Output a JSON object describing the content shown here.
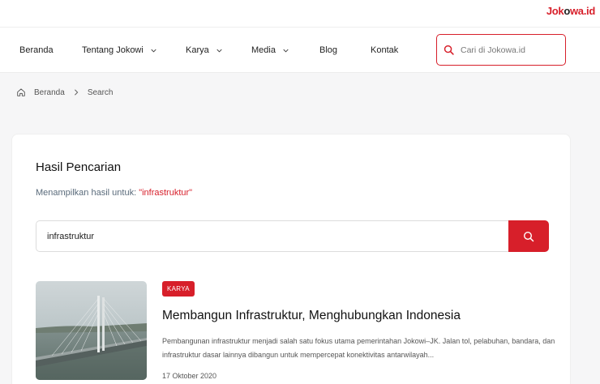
{
  "brand": {
    "logo_part1": "Jok",
    "logo_part2": "o",
    "logo_part3": "wa.id",
    "accent": "#d71f2a"
  },
  "nav": {
    "items": [
      {
        "label": "Beranda",
        "has_dropdown": false
      },
      {
        "label": "Tentang Jokowi",
        "has_dropdown": true
      },
      {
        "label": "Karya",
        "has_dropdown": true
      },
      {
        "label": "Media",
        "has_dropdown": true
      },
      {
        "label": "Blog",
        "has_dropdown": false
      },
      {
        "label": "Kontak",
        "has_dropdown": false
      }
    ],
    "search_placeholder": "Cari di Jokowa.id"
  },
  "breadcrumb": {
    "home": "Beranda",
    "current": "Search"
  },
  "main": {
    "title": "Hasil Pencarian",
    "subtitle_prefix": "Menampilkan hasil untuk: ",
    "query_quoted": "\"infrastruktur\"",
    "search_value": "infrastruktur"
  },
  "results": [
    {
      "badge": "KARYA",
      "title": "Membangun Infrastruktur, Menghubungkan Indonesia",
      "excerpt": "Pembangunan infrastruktur menjadi salah satu fokus utama pemerintahan Jokowi–JK. Jalan tol, pelabuhan, bandara, dan infrastruktur dasar lainnya dibangun untuk mempercepat konektivitas antarwilayah...",
      "date": "17 Oktober 2020",
      "image": "bridge-photo"
    }
  ]
}
